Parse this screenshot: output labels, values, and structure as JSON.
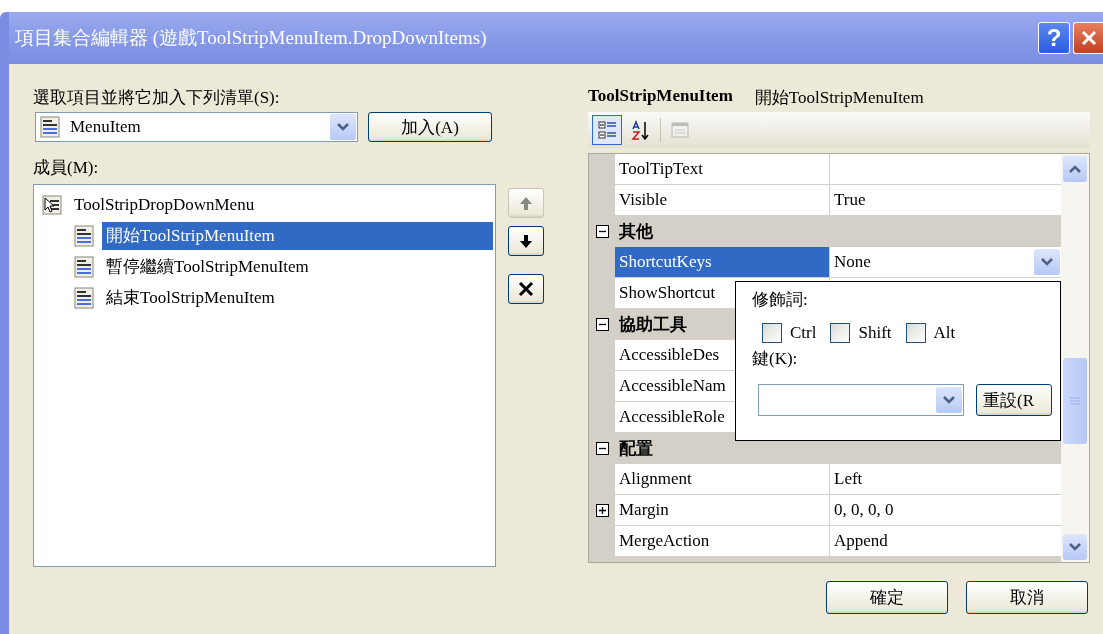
{
  "window": {
    "title": "項目集合編輯器 (遊戲ToolStripMenuItem.DropDownItems)",
    "help_button": "?"
  },
  "add_section": {
    "label": "選取項目並將它加入下列清單(S):",
    "combo": {
      "value": "MenuItem"
    },
    "add_button": "加入(A)"
  },
  "members": {
    "label": "成員(M):",
    "tree": [
      {
        "label": "ToolStripDropDownMenu",
        "selected": false,
        "children": [
          {
            "label": "開始ToolStripMenuItem",
            "selected": true
          },
          {
            "label": "暫停繼續ToolStripMenuItem",
            "selected": false
          },
          {
            "label": "結束ToolStripMenuItem",
            "selected": false
          }
        ]
      }
    ]
  },
  "move_buttons": [
    {
      "kind": "up",
      "disabled": true
    },
    {
      "kind": "down",
      "disabled": false
    },
    {
      "kind": "delete",
      "disabled": false
    }
  ],
  "properties": {
    "header": {
      "type": "ToolStripMenuItem",
      "name": "開始ToolStripMenuItem"
    },
    "toolbar": [
      {
        "kind": "categorized",
        "selected": true,
        "disabled": false
      },
      {
        "kind": "alphabetical",
        "selected": false,
        "disabled": false
      },
      {
        "kind": "pages",
        "selected": false,
        "disabled": true
      }
    ],
    "rows": [
      {
        "kind": "property",
        "name": "ToolTipText",
        "selected": false,
        "has_children": false
      },
      {
        "kind": "property",
        "name": "Visible",
        "value": "True",
        "selected": false,
        "has_children": false
      },
      {
        "kind": "category",
        "name": "其他",
        "expanded": true
      },
      {
        "kind": "property",
        "name": "ShortcutKeys",
        "value": "None",
        "selected": true,
        "has_children": false
      },
      {
        "kind": "property",
        "name": "ShowShortcut",
        "selected": false,
        "has_children": false
      },
      {
        "kind": "category",
        "name": "協助工具",
        "expanded": true
      },
      {
        "kind": "property",
        "name": "AccessibleDes",
        "selected": false,
        "has_children": false
      },
      {
        "kind": "property",
        "name": "AccessibleNam",
        "selected": false,
        "has_children": false
      },
      {
        "kind": "property",
        "name": "AccessibleRole",
        "selected": false,
        "has_children": false
      },
      {
        "kind": "category",
        "name": "配置",
        "expanded": true
      },
      {
        "kind": "property",
        "name": "Alignment",
        "value": "Left",
        "selected": false,
        "has_children": false
      },
      {
        "kind": "property",
        "name": "Margin",
        "value": "0, 0, 0, 0",
        "selected": false,
        "has_children": true
      },
      {
        "kind": "property",
        "name": "MergeAction",
        "value": "Append",
        "selected": false,
        "has_children": false
      }
    ],
    "popup": {
      "modifiers_label": "修飾詞:",
      "modifiers": [
        {
          "label": "Ctrl",
          "checked": false
        },
        {
          "label": "Shift",
          "checked": false
        },
        {
          "label": "Alt",
          "checked": false
        }
      ],
      "key_label": "鍵(K):",
      "reset_button": "重設(R"
    }
  },
  "buttons": [
    "確定",
    "取消"
  ]
}
